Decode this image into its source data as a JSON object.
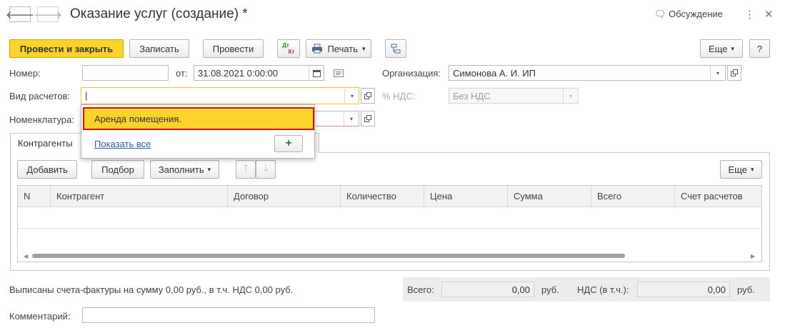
{
  "window": {
    "title": "Оказание услуг (создание) *",
    "discussion_label": "Обсуждение",
    "back_glyph": "🡐",
    "forward_glyph": "🡒",
    "more_glyph": "⋮",
    "close_glyph": "✕",
    "discussion_glyph": "🗨"
  },
  "toolbar": {
    "post_close_label": "Провести и закрыть",
    "save_label": "Записать",
    "post_label": "Провести",
    "dtkt_top": "Дт",
    "dtkt_bottom": "Кт",
    "print_label": "Печать",
    "more_label": "Еще",
    "help_label": "?",
    "dropdown_arrow": "▾"
  },
  "form": {
    "number_label": "Номер:",
    "number_value": "",
    "date_label": "от:",
    "date_value": "31.08.2021  0:00:00",
    "org_label": "Организация:",
    "org_value": "Симонова А. И. ИП",
    "calc_type_label": "Вид расчетов:",
    "calc_type_value": "|",
    "vat_label": "% НДС:",
    "vat_value": "Без НДС",
    "nomenclature_label": "Номенклатура:"
  },
  "dropdown": {
    "item": "Аренда помещения.",
    "show_all": "Показать все",
    "add_glyph": "+"
  },
  "tabs": {
    "counterparties": "Контрагенты"
  },
  "table_toolbar": {
    "add_label": "Добавить",
    "select_label": "Подбор",
    "fill_label": "Заполнить",
    "up_glyph": "🡑",
    "down_glyph": "🡓",
    "more_label": "Еще"
  },
  "table": {
    "columns": [
      "N",
      "Контрагент",
      "Договор",
      "Количество",
      "Цена",
      "Сумма",
      "Всего",
      "Счет расчетов"
    ]
  },
  "footer": {
    "invoices_text": "Выписаны счета-фактуры на сумму 0,00 руб., в т.ч. НДС 0,00 руб.",
    "total_label": "Всего:",
    "total_value": "0,00",
    "currency": "руб.",
    "vat_total_label": "НДС (в т.ч.):",
    "vat_total_value": "0,00",
    "currency2": "руб.",
    "comment_label": "Комментарий:",
    "comment_value": ""
  },
  "colors": {
    "accent": "#fbd32a",
    "highlight_border": "#d0151a",
    "link": "#2b5fa6"
  }
}
